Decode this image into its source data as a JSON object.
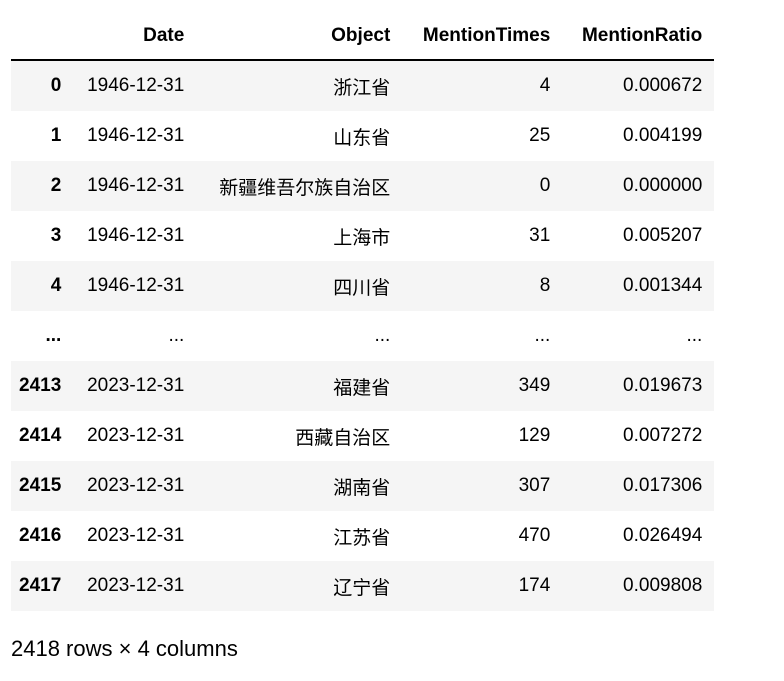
{
  "table": {
    "columns": [
      "Date",
      "Object",
      "MentionTimes",
      "MentionRatio"
    ],
    "rows": [
      {
        "index": "0",
        "Date": "1946-12-31",
        "Object": "浙江省",
        "MentionTimes": "4",
        "MentionRatio": "0.000672"
      },
      {
        "index": "1",
        "Date": "1946-12-31",
        "Object": "山东省",
        "MentionTimes": "25",
        "MentionRatio": "0.004199"
      },
      {
        "index": "2",
        "Date": "1946-12-31",
        "Object": "新疆维吾尔族自治区",
        "MentionTimes": "0",
        "MentionRatio": "0.000000"
      },
      {
        "index": "3",
        "Date": "1946-12-31",
        "Object": "上海市",
        "MentionTimes": "31",
        "MentionRatio": "0.005207"
      },
      {
        "index": "4",
        "Date": "1946-12-31",
        "Object": "四川省",
        "MentionTimes": "8",
        "MentionRatio": "0.001344"
      },
      {
        "index": "...",
        "Date": "...",
        "Object": "...",
        "MentionTimes": "...",
        "MentionRatio": "..."
      },
      {
        "index": "2413",
        "Date": "2023-12-31",
        "Object": "福建省",
        "MentionTimes": "349",
        "MentionRatio": "0.019673"
      },
      {
        "index": "2414",
        "Date": "2023-12-31",
        "Object": "西藏自治区",
        "MentionTimes": "129",
        "MentionRatio": "0.007272"
      },
      {
        "index": "2415",
        "Date": "2023-12-31",
        "Object": "湖南省",
        "MentionTimes": "307",
        "MentionRatio": "0.017306"
      },
      {
        "index": "2416",
        "Date": "2023-12-31",
        "Object": "江苏省",
        "MentionTimes": "470",
        "MentionRatio": "0.026494"
      },
      {
        "index": "2417",
        "Date": "2023-12-31",
        "Object": "辽宁省",
        "MentionTimes": "174",
        "MentionRatio": "0.009808"
      }
    ],
    "summary": "2418 rows × 4 columns"
  }
}
